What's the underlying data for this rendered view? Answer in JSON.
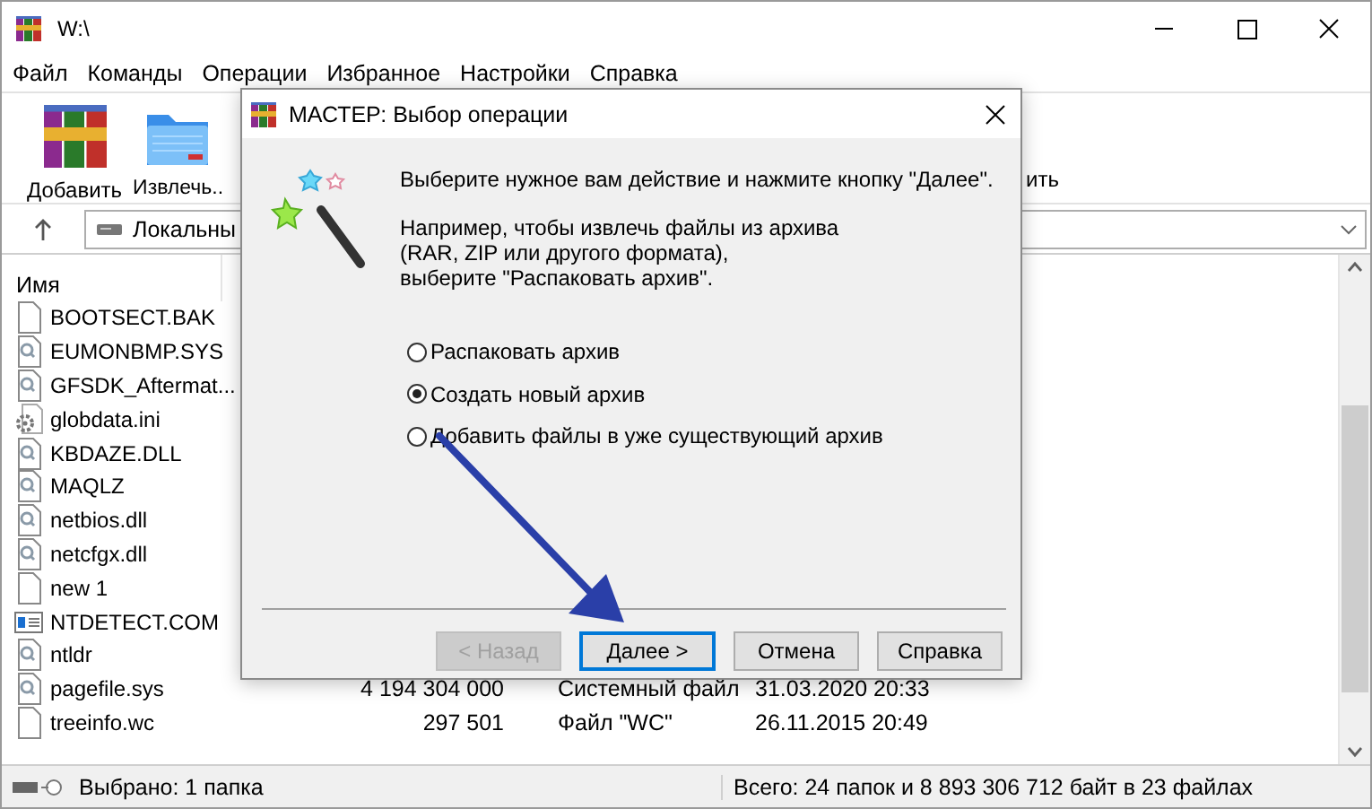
{
  "window": {
    "title": "W:\\"
  },
  "menu": [
    {
      "label": "Файл"
    },
    {
      "label": "Команды"
    },
    {
      "label": "Операции"
    },
    {
      "label": "Избранное"
    },
    {
      "label": "Настройки"
    },
    {
      "label": "Справка"
    }
  ],
  "toolbar": [
    {
      "label": "Добавить",
      "kind": "add"
    },
    {
      "label": "Извлечь..",
      "kind": "extract"
    }
  ],
  "toolbar_fragment": "ить",
  "address": {
    "value": "Локальны"
  },
  "file_list": {
    "column_header": "Имя",
    "rows": [
      {
        "name": "BOOTSECT.BAK",
        "kind": "blank"
      },
      {
        "name": "EUMONBMP.SYS",
        "kind": "system"
      },
      {
        "name": "GFSDK_Aftermat...",
        "kind": "system"
      },
      {
        "name": "globdata.ini",
        "kind": "settings"
      },
      {
        "name": "KBDAZE.DLL",
        "kind": "system"
      },
      {
        "name": "MAQLZ",
        "kind": "system"
      },
      {
        "name": "netbios.dll",
        "kind": "system"
      },
      {
        "name": "netcfgx.dll",
        "kind": "system"
      },
      {
        "name": "new 1",
        "kind": "blank"
      },
      {
        "name": "NTDETECT.COM",
        "kind": "app"
      },
      {
        "name": "ntldr",
        "kind": "system"
      },
      {
        "name": "pagefile.sys",
        "kind": "system",
        "size": "4 194 304 000",
        "type": "Системный файл",
        "date": "31.03.2020 20:33"
      },
      {
        "name": "treeinfo.wc",
        "kind": "blank",
        "size": "297 501",
        "type": "Файл \"WC\"",
        "date": "26.11.2015 20:49"
      }
    ]
  },
  "status_bar": {
    "left": "Выбрано: 1 папка",
    "right": "Всего: 24 папок и 8 893 306 712 байт в 23 файлах"
  },
  "dialog": {
    "title": "МАСТЕР:  Выбор операции",
    "intro": "Выберите нужное вам действие и нажмите кнопку \"Далее\".",
    "hint_lines": [
      "Например, чтобы извлечь файлы из архива",
      "(RAR, ZIP или другого формата),",
      "выберите \"Распаковать архив\"."
    ],
    "options": [
      {
        "label": "Распаковать архив",
        "selected": false
      },
      {
        "label": "Создать новый архив",
        "selected": true
      },
      {
        "label": "Добавить файлы в уже существующий архив",
        "selected": false
      }
    ],
    "buttons": [
      {
        "label": "< Назад",
        "disabled": true,
        "default": false
      },
      {
        "label": "Далее >",
        "disabled": false,
        "default": true
      },
      {
        "label": "Отмена",
        "disabled": false,
        "default": false
      },
      {
        "label": "Справка",
        "disabled": false,
        "default": false
      }
    ]
  }
}
